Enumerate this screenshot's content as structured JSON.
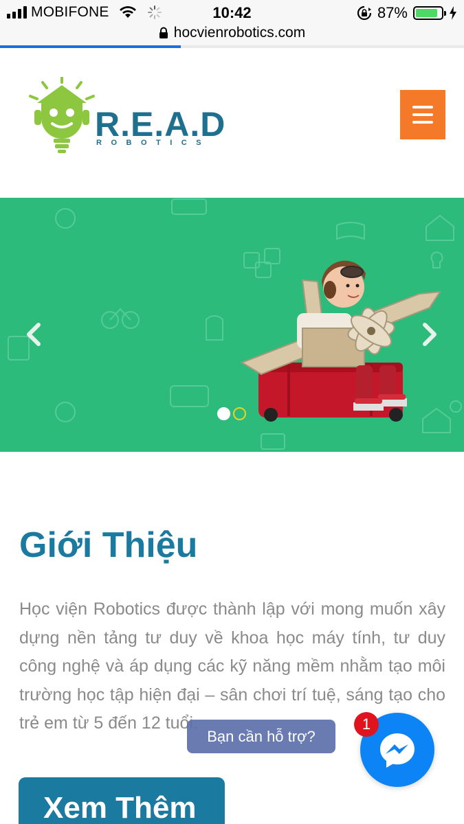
{
  "status_bar": {
    "carrier": "MOBIFONE",
    "time": "10:42",
    "battery_percent": "87%",
    "battery_level": 0.87,
    "icons": [
      "signal-bars-icon",
      "wifi-icon",
      "loading-spinner-icon",
      "rotation-lock-icon",
      "battery-icon",
      "charging-bolt-icon"
    ]
  },
  "browser": {
    "url": "hocvienrobotics.com",
    "load_progress": 0.39
  },
  "header": {
    "logo_text": "R.E.A.D",
    "logo_subtext": "ROBOTICS",
    "menu_icon": "hamburger-icon"
  },
  "slider": {
    "slide_count": 2,
    "active_slide": 1,
    "prev_icon": "chevron-left-icon",
    "next_icon": "chevron-right-icon"
  },
  "intro": {
    "title": "Giới Thiệu",
    "body": "Học viện Robotics được thành lập với mong muốn xây dựng nền tảng tư duy về khoa học máy tính, tư duy công nghệ và áp dụng các kỹ năng mềm nhằm tạo môi trường học tập hiện đại – sân chơi trí tuệ, sáng tạo cho trẻ em từ 5 đến 12 tuổi.",
    "more_button": "Xem Thêm"
  },
  "chat": {
    "support_label": "Bạn cần hỗ trợ?",
    "badge_count": "1",
    "icon": "messenger-icon"
  },
  "colors": {
    "brand_blue": "#1a7aa0",
    "slider_green": "#2dbb7c",
    "menu_orange": "#f47a2a",
    "messenger_blue": "#0d84f5"
  }
}
